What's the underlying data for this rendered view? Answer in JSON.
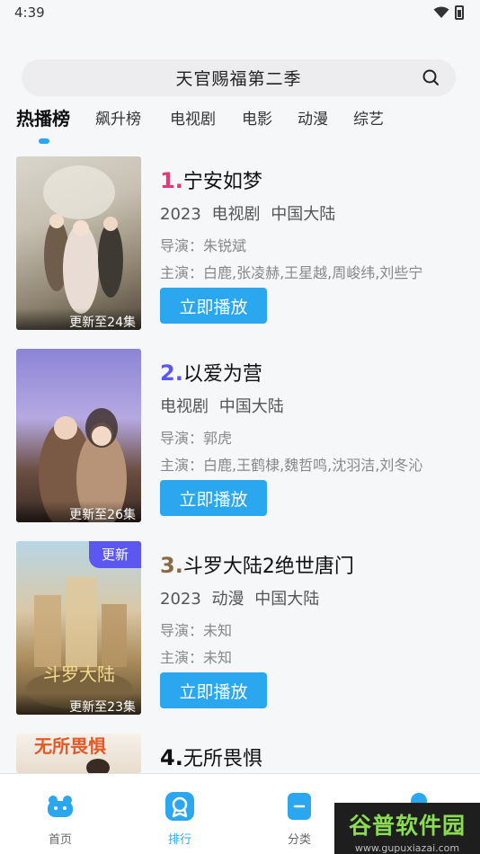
{
  "status_bar": {
    "time": "4:39"
  },
  "search": {
    "text": "天官赐福第二季"
  },
  "tabs": [
    {
      "label": "热播榜",
      "active": true
    },
    {
      "label": "飙升榜"
    },
    {
      "label": "电视剧"
    },
    {
      "label": "电影"
    },
    {
      "label": "动漫"
    },
    {
      "label": "综艺"
    }
  ],
  "items": [
    {
      "rank": "1.",
      "rank_color": "#e03a7c",
      "title": "宁安如梦",
      "meta": "2023 电视剧 中国大陆",
      "director": "导演：朱锐斌",
      "actors": "主演：白鹿,张凌赫,王星越,周峻纬,刘些宁",
      "update": "更新至24集",
      "play": "立即播放"
    },
    {
      "rank": "2.",
      "rank_color": "#5b57f0",
      "title": "以爱为营",
      "meta": " 电视剧 中国大陆",
      "director": "导演：郭虎",
      "actors": "主演：白鹿,王鹤棣,魏哲鸣,沈羽洁,刘冬沁",
      "update": "更新至26集",
      "play": "立即播放"
    },
    {
      "rank": "3.",
      "rank_color": "#8a6a44",
      "title": "斗罗大陆2绝世唐门",
      "meta": "2023 动漫 中国大陆",
      "director": "导演：未知",
      "actors": "主演：未知",
      "update": "更新至23集",
      "new_badge": "更新",
      "play": "立即播放"
    },
    {
      "rank": "4.",
      "rank_color": "#111111",
      "title": "无所畏惧",
      "poster_text": "无所畏惧"
    }
  ],
  "bottom_nav": [
    {
      "label": "首页"
    },
    {
      "label": "排行",
      "active": true
    },
    {
      "label": "分类"
    },
    {
      "label": ""
    }
  ],
  "watermark": {
    "main": "谷普软件园",
    "url": "www.gupuxiazai.com"
  },
  "colors": {
    "accent": "#2aa7ee"
  }
}
